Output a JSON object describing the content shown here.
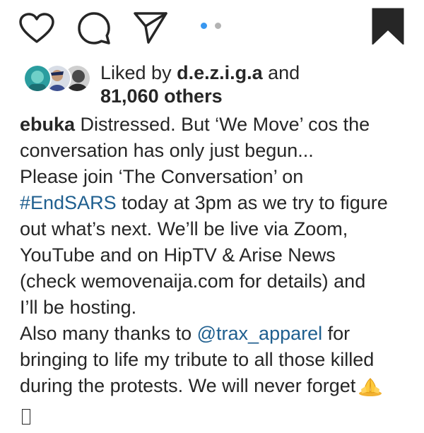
{
  "actions": {
    "like_icon": "heart-icon",
    "comment_icon": "comment-icon",
    "share_icon": "paper-plane-icon",
    "save_icon": "bookmark-icon",
    "carousel": {
      "count": 2,
      "active_index": 0
    }
  },
  "likes": {
    "prefix": "Liked by ",
    "user": "d.e.z.i.g.a",
    "and": " and",
    "others": "81,060 others"
  },
  "caption": {
    "username": "ebuka",
    "line1_text": " Distressed. But ‘We Move’ cos the",
    "line2": "conversation has only just begun...",
    "line3": "Please join ‘The Conversation’ on",
    "hashtag": "#EndSARS",
    "line4_rest": " today at 3pm as we try to figure",
    "line5": "out what’s next. We’ll be live via Zoom,",
    "line6": "YouTube and on HipTV & Arise News",
    "line7": "(check wemovenaija.com for details) and",
    "line8": "I’ll be hosting.",
    "line9_pre": "Also many thanks to ",
    "mention": "@trax_apparel",
    "line9_post": " for",
    "line10": "bringing to life my tribute to all those killed",
    "line11": "during the protests. We will never forget"
  },
  "colors": {
    "link": "#1f5f8f",
    "carousel_active": "#3897f0",
    "carousel_inactive": "#b3b3b3"
  }
}
